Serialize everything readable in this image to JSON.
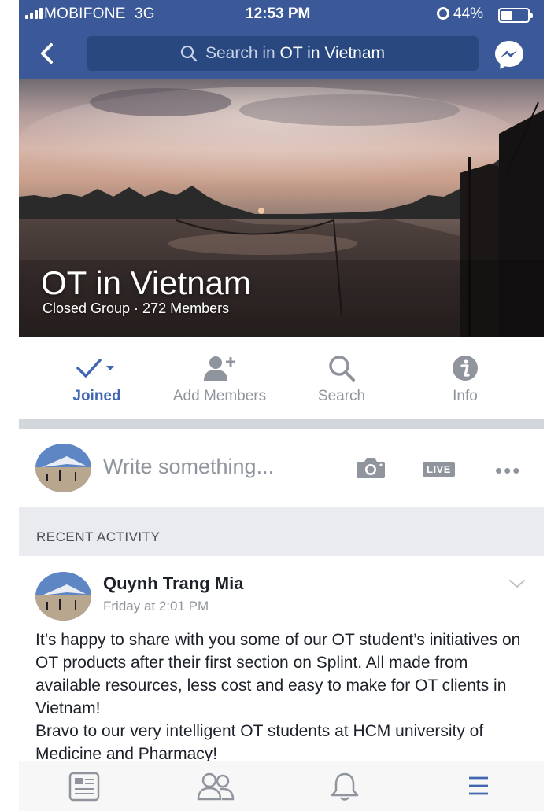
{
  "status_bar": {
    "carrier": "MOBIFONE",
    "network": "3G",
    "time": "12:53 PM",
    "battery": "44%",
    "battery_level": 0.44
  },
  "nav": {
    "search_prefix": "Search in",
    "search_group": "OT in Vietnam",
    "back_icon": "chevron-left-icon",
    "messenger_icon": "messenger-icon"
  },
  "group": {
    "name": "OT in Vietnam",
    "meta": "Closed Group · 272 Members"
  },
  "actions": [
    {
      "label": "Joined",
      "icon": "checkmark-icon",
      "active": true
    },
    {
      "label": "Add Members",
      "icon": "add-person-icon"
    },
    {
      "label": "Search",
      "icon": "search-icon"
    },
    {
      "label": "Info",
      "icon": "info-icon"
    }
  ],
  "composer": {
    "placeholder": "Write something...",
    "live_label": "LIVE",
    "more": "•••"
  },
  "section": {
    "title": "RECENT ACTIVITY"
  },
  "post": {
    "author": "Quynh Trang Mia",
    "time": "Friday at 2:01 PM",
    "body": "It’s happy to share with you some of our OT student’s initiatives on OT products after their first section on Splint. All made from available resources, less cost and easy to make for OT clients in Vietnam!\nBravo to our very intelligent OT students at HCM university of Medicine and Pharmacy!"
  },
  "tabbar": [
    {
      "icon": "news-feed-icon"
    },
    {
      "icon": "friends-icon"
    },
    {
      "icon": "notifications-bell-icon"
    },
    {
      "icon": "menu-icon",
      "active": true
    }
  ],
  "colors": {
    "brand": "#3b5998",
    "accent": "#4267b2",
    "muted": "#90949c"
  }
}
